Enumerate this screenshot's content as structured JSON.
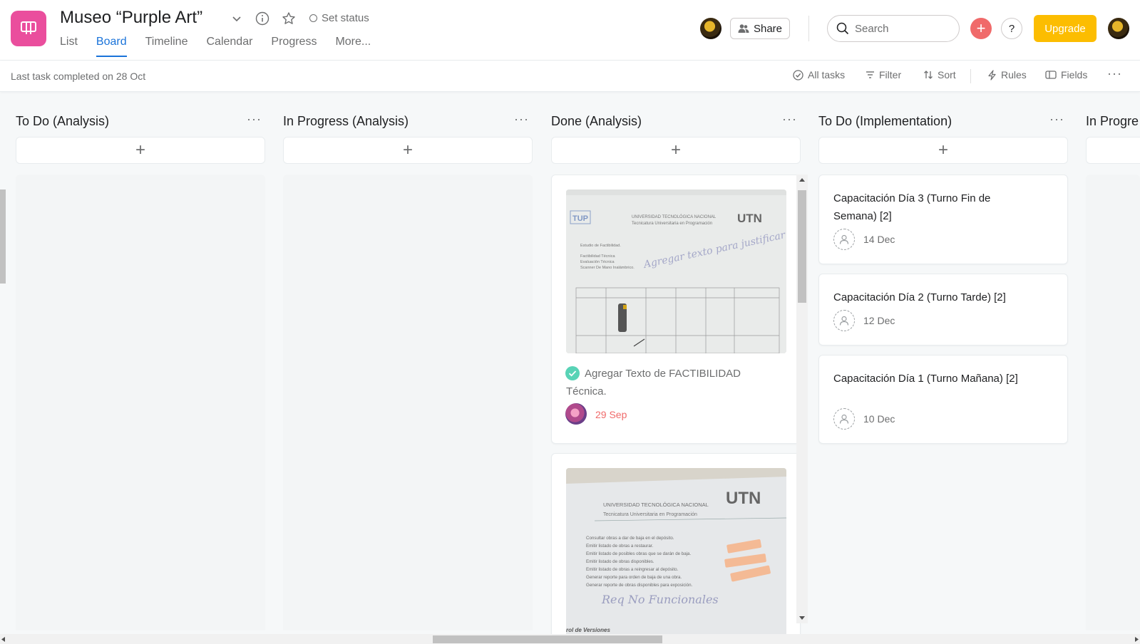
{
  "project": {
    "title": "Museo “Purple Art”",
    "set_status_label": "Set status",
    "icon_color": "#ea4e9d"
  },
  "tabs": [
    {
      "label": "List",
      "active": false
    },
    {
      "label": "Board",
      "active": true
    },
    {
      "label": "Timeline",
      "active": false
    },
    {
      "label": "Calendar",
      "active": false
    },
    {
      "label": "Progress",
      "active": false
    },
    {
      "label": "More..."
    }
  ],
  "header": {
    "share_label": "Share",
    "search_placeholder": "Search",
    "upgrade_label": "Upgrade",
    "add_label": "+",
    "help_label": "?"
  },
  "subbar": {
    "last_task": "Last task completed on 28 Oct",
    "all_tasks": "All tasks",
    "filter": "Filter",
    "sort": "Sort",
    "rules": "Rules",
    "fields": "Fields"
  },
  "columns": [
    {
      "title": "To Do (Analysis)",
      "cards": []
    },
    {
      "title": "In Progress (Analysis)",
      "cards": []
    },
    {
      "title": "Done (Analysis)",
      "cards": [
        {
          "title": "Agregar Texto de FACTIBILIDAD Técnica.",
          "date": "29 Sep",
          "completed": true
        }
      ]
    },
    {
      "title": "To Do (Implementation)",
      "cards": [
        {
          "title": "Capacitación Día 3 (Turno Fin de Semana) [2]",
          "date": "14 Dec"
        },
        {
          "title": "Capacitación Día 2 (Turno Tarde) [2]",
          "date": "12 Dec"
        },
        {
          "title": "Capacitación Día 1 (Turno Mañana) [2]",
          "date": "10 Dec"
        }
      ]
    },
    {
      "title": "In Progre"
    }
  ],
  "colors": {
    "accent": "#1a73d9",
    "upgrade": "#fcbd01",
    "add": "#f06a6a",
    "completed_check": "#58d3b6",
    "overdue_date": "#f06a6a"
  },
  "cover_images": {
    "doc1": {
      "header": "UNIVERSIDAD TECNOLÓGICA NACIONAL",
      "sub": "Tecnicatura Universitaria en Programación",
      "logo": "UTN",
      "tup": "TUP",
      "lines": [
        "Estudio de Factibilidad.",
        "Factibilidad Técnica",
        "Evaluación Técnica",
        "Scanner De Mano Inalámbrico."
      ],
      "handwriting": "Agregar texto para justificar factib. técnica"
    },
    "doc2": {
      "header": "UNIVERSIDAD TECNOLÓGICA NACIONAL",
      "sub": "Tecnicatura Universitaria en Programación",
      "logo": "UTN",
      "items": [
        "Consultar obras a dar de baja en el depósito.",
        "Emitir listado de obras a restaurar.",
        "Emitir listado de posibles obras que se darán de baja.",
        "Emitir listado de obras disponibles.",
        "Emitir listado de obras a reingresar al depósito.",
        "Generar reporte para orden de baja de una obra.",
        "Generar reporte de obras disponibles para exposición."
      ],
      "handwriting": "Req No Funcionales",
      "footer": "rol de Versiones"
    }
  }
}
